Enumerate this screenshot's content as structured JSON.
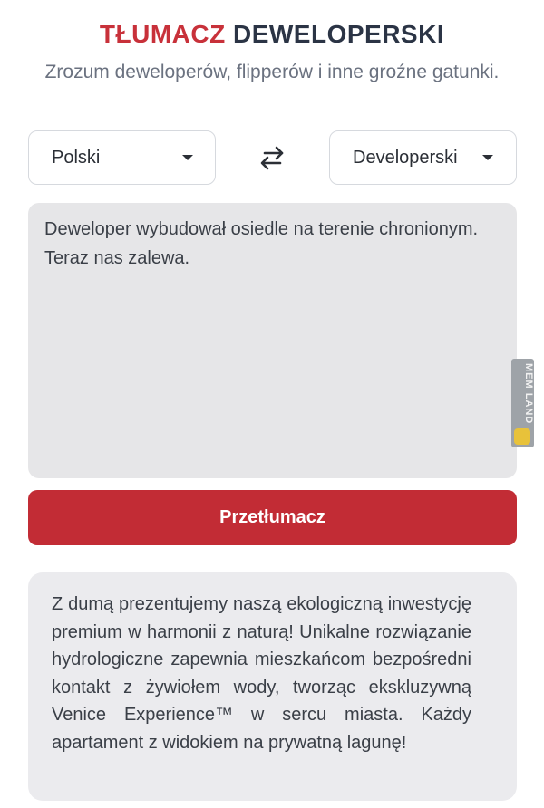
{
  "header": {
    "title_accent": "TŁUMACZ",
    "title_rest": "DEWELOPERSKI",
    "subtitle": "Zrozum deweloperów, flipperów i inne groźne gatunki."
  },
  "source_language": {
    "selected": "Polski"
  },
  "target_language": {
    "selected": "Developerski"
  },
  "swap_icon": "swap-arrows-icon",
  "input": {
    "value": "Deweloper wybudował osiedle na terenie chronionym. Teraz nas zalewa."
  },
  "translate_button": {
    "label": "Przetłumacz"
  },
  "output": {
    "text": "Z dumą prezentujemy naszą ekologiczną inwestycję premium w harmonii z naturą! Unikalne rozwiązanie hydrologiczne zapewnia mieszkańcom bezpośredni kontakt z żywiołem wody, tworząc ekskluzywną Venice Experience™ w sercu miasta. Każdy apartament z widokiem na prywatną lagunę!"
  },
  "watermark": {
    "text": "MEM LAND"
  },
  "colors": {
    "accent": "#c8313a",
    "button": "#c22c35",
    "title": "#2b3445",
    "input_bg": "#e6e6e8",
    "output_bg": "#ebebee"
  }
}
